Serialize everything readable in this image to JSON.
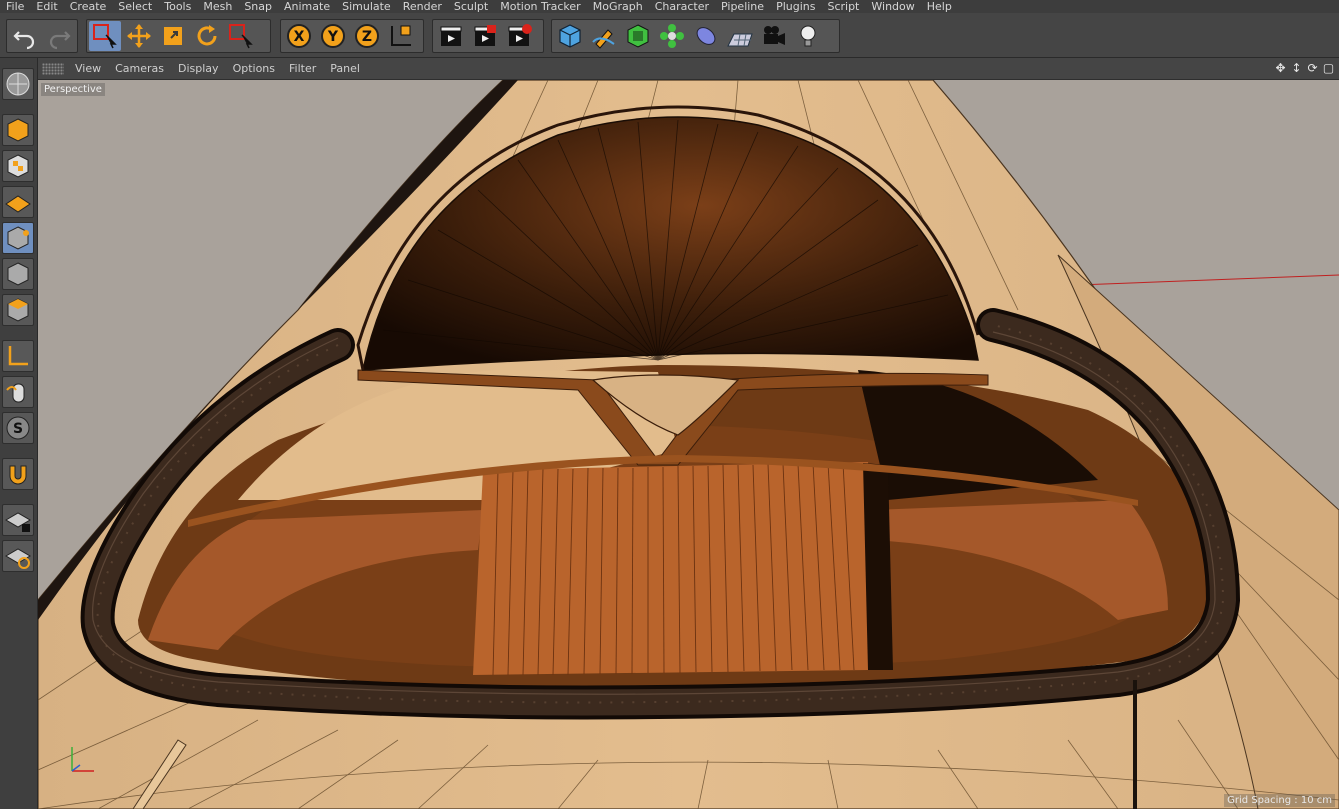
{
  "menu": [
    "File",
    "Edit",
    "Create",
    "Select",
    "Tools",
    "Mesh",
    "Snap",
    "Animate",
    "Simulate",
    "Render",
    "Sculpt",
    "Motion Tracker",
    "MoGraph",
    "Character",
    "Pipeline",
    "Plugins",
    "Script",
    "Window",
    "Help"
  ],
  "toolbar": {
    "undo_icon": "undo-icon",
    "redo_icon": "redo-icon",
    "tools": [
      "live-selection-icon",
      "move-icon",
      "scale-icon",
      "rotate-icon",
      "recent-tool-icon"
    ],
    "axis_x": "X",
    "axis_y": "Y",
    "axis_z": "Z",
    "render_tools": [
      "render-view-icon",
      "render-picture-viewer-icon",
      "render-settings-icon"
    ],
    "object_tools": [
      "cube-icon",
      "pen-icon",
      "subdivision-icon",
      "cloner-icon",
      "deformer-icon",
      "floor-icon",
      "camera-icon",
      "light-icon"
    ],
    "accent": "#6f8fbf"
  },
  "viewport_menu": [
    "View",
    "Cameras",
    "Display",
    "Options",
    "Filter",
    "Panel"
  ],
  "viewport": {
    "camera_label": "Perspective",
    "grid_spacing": "Grid Spacing : 10 cm",
    "bg_color": "#a9a29b"
  },
  "left_tools": [
    "make-editable-icon",
    "model-mode-icon",
    "texture-mode-icon",
    "points-mode-icon",
    "edges-mode-icon",
    "polygons-mode-icon",
    "axis-mode-icon",
    "tweak-mode-icon",
    "solo-icon",
    "snap-magnet-icon",
    "workplane-lock-icon",
    "workplane-rotate-icon"
  ]
}
